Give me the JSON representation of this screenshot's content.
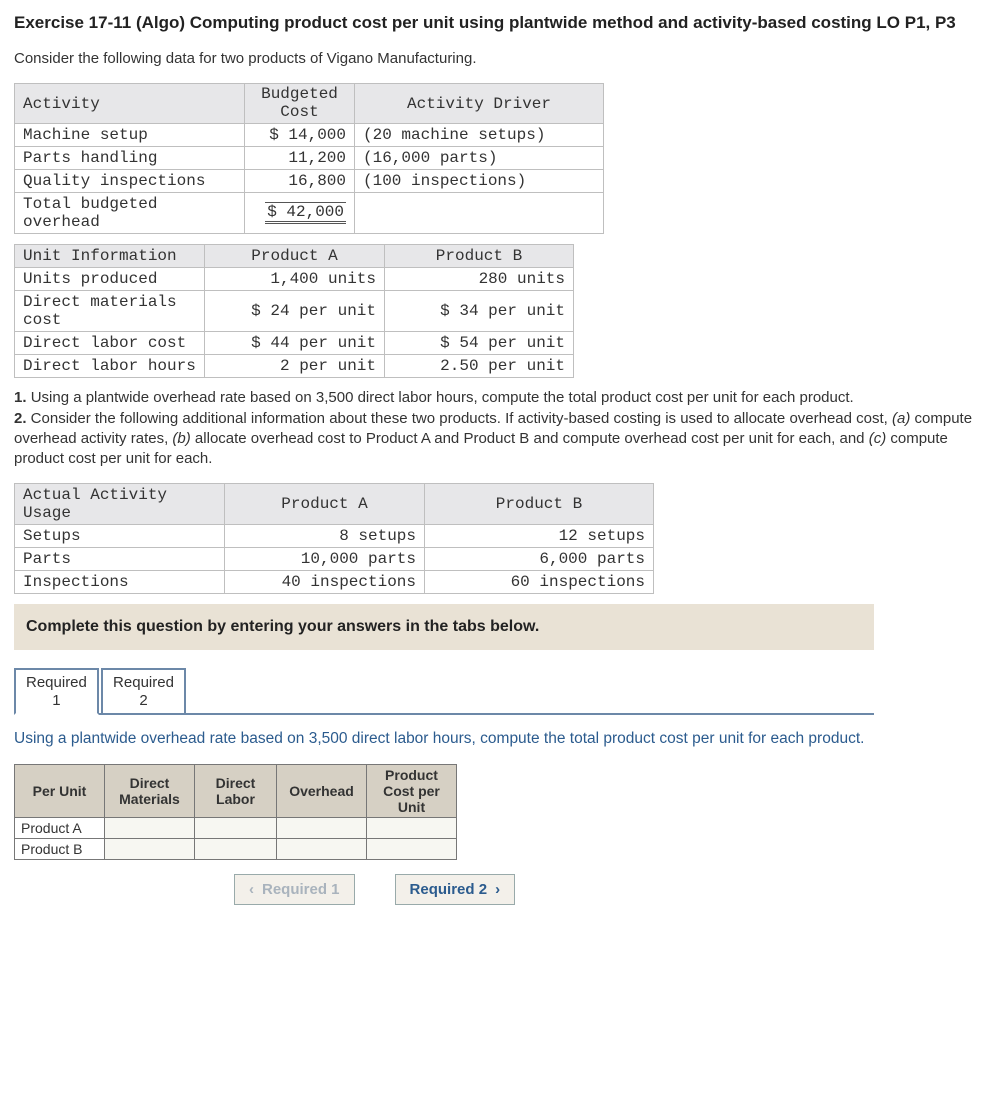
{
  "title": "Exercise 17-11 (Algo) Computing product cost per unit using plantwide method and activity-based costing LO P1, P3",
  "intro": "Consider the following data for two products of Vigano Manufacturing.",
  "table1": {
    "headers": [
      "Activity",
      "Budgeted Cost",
      "Activity Driver"
    ],
    "rows": [
      {
        "activity": "Machine setup",
        "cost": "$ 14,000",
        "driver": "(20 machine setups)"
      },
      {
        "activity": "Parts handling",
        "cost": "11,200",
        "driver": "(16,000 parts)"
      },
      {
        "activity": "Quality inspections",
        "cost": "16,800",
        "driver": "(100 inspections)"
      },
      {
        "activity": "Total budgeted overhead",
        "cost": "$ 42,000",
        "driver": ""
      }
    ]
  },
  "table2": {
    "headers": [
      "Unit Information",
      "Product A",
      "Product B"
    ],
    "rows": [
      {
        "label": "Units produced",
        "a": "1,400 units",
        "b": "280 units"
      },
      {
        "label": "Direct materials cost",
        "a": "$ 24 per unit",
        "b": "$ 34 per unit"
      },
      {
        "label": "Direct labor cost",
        "a": "$ 44 per unit",
        "b": "$ 54 per unit"
      },
      {
        "label": "Direct labor hours",
        "a": "2 per unit",
        "b": "2.50 per unit"
      }
    ]
  },
  "q1": "1. Using a plantwide overhead rate based on 3,500 direct labor hours, compute the total product cost per unit for each product.",
  "q2": "2. Consider the following additional information about these two products. If activity-based costing is used to allocate overhead cost, (a) compute overhead activity rates, (b) allocate overhead cost to Product A and Product B and compute overhead cost per unit for each, and (c) compute product cost per unit for each.",
  "table3": {
    "headers": [
      "Actual Activity Usage",
      "Product A",
      "Product B"
    ],
    "rows": [
      {
        "label": "Setups",
        "a": "8 setups",
        "b": "12 setups"
      },
      {
        "label": "Parts",
        "a": "10,000 parts",
        "b": "6,000 parts"
      },
      {
        "label": "Inspections",
        "a": "40 inspections",
        "b": "60 inspections"
      }
    ]
  },
  "complete_banner": "Complete this question by entering your answers in the tabs below.",
  "tabs": {
    "req1": "Required 1",
    "req2": "Required 2"
  },
  "tab_desc": "Using a plantwide overhead rate based on 3,500 direct labor hours, compute the total product cost per unit for each product.",
  "answer_table": {
    "headers": [
      "Per Unit",
      "Direct Materials",
      "Direct Labor",
      "Overhead",
      "Product Cost per Unit"
    ],
    "rows": [
      "Product A",
      "Product B"
    ]
  },
  "nav": {
    "prev": "Required 1",
    "next": "Required 2"
  }
}
